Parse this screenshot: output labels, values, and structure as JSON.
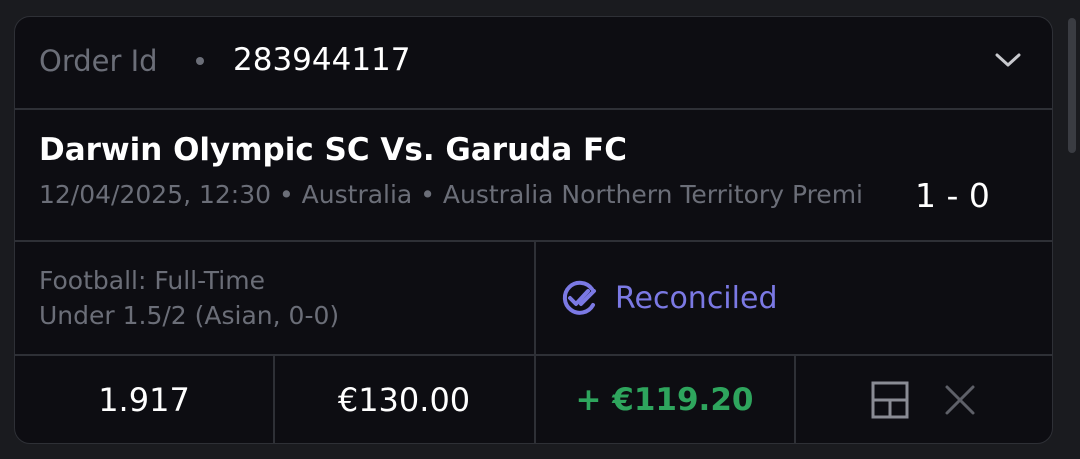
{
  "order": {
    "label": "Order Id",
    "id": "283944117"
  },
  "match": {
    "title": "Darwin Olympic SC Vs. Garuda FC",
    "meta": "12/04/2025, 12:30 • Australia • Australia Northern Territory Premi",
    "score": "1 - 0"
  },
  "bet": {
    "market_line1": "Football: Full-Time",
    "market_line2": "Under 1.5/2 (Asian, 0-0)",
    "status": "Reconciled",
    "odds": "1.917",
    "stake": "€130.00",
    "profit": "+ €119.20"
  },
  "icons": {
    "expand": "chevron-down-icon",
    "status": "double-check-icon",
    "layout": "grid-icon",
    "remove": "close-icon"
  },
  "colors": {
    "background": "#0d0d12",
    "status": "#7b79e4",
    "profit": "#2ea55d",
    "muted": "#6b6e78"
  }
}
